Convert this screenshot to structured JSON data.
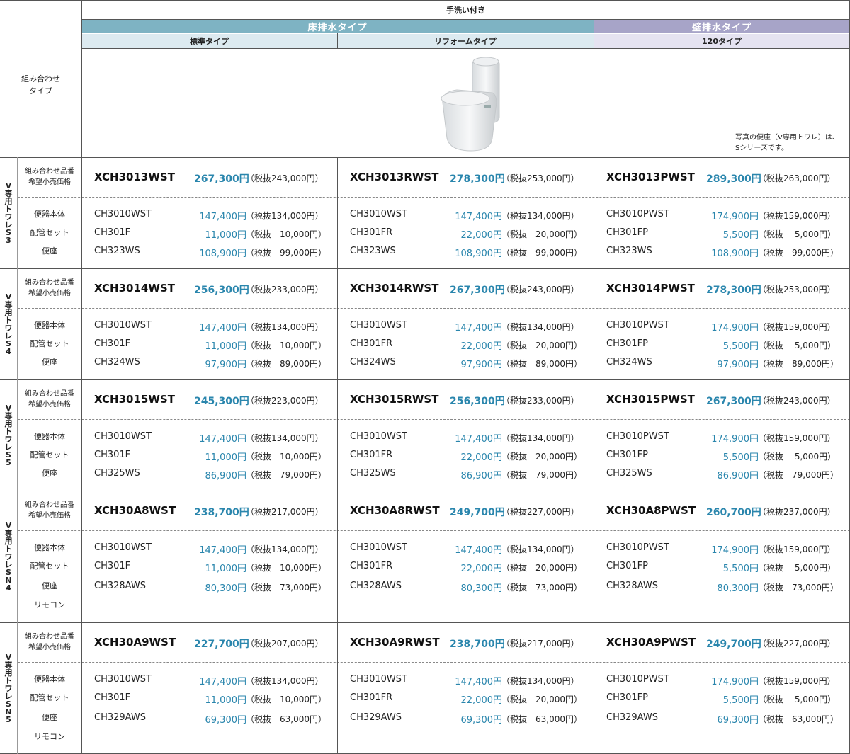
{
  "header": {
    "top": "手洗い付き",
    "floor_band": "床排水タイプ",
    "wall_band": "壁排水タイプ",
    "sub_standard": "標準タイプ",
    "sub_reform": "リフォームタイプ",
    "sub_120": "120タイプ"
  },
  "combo_type_label": [
    "組み合わせ",
    "タイプ"
  ],
  "photo_note": [
    "写真の便座（V専用トワレ）は、",
    "Sシリーズです。"
  ],
  "row_labels": {
    "combo": [
      "組み合わせ品番",
      "希望小売価格"
    ],
    "body": "便器本体",
    "pipe": "配管セット",
    "seat": "便座",
    "remote": "リモコン"
  },
  "colors": {
    "floor_band": "#7eb3c3",
    "wall_band": "#a7a4c8",
    "price": "#2a86ad"
  },
  "groups": [
    {
      "series": "V専用トワレS3",
      "cols": [
        {
          "code": "XCH3013WST",
          "price": "267,300円",
          "tax": "（税抜243,000円）",
          "parts": [
            {
              "code": "CH3010WST",
              "price": "147,400円",
              "tax": "（税抜134,000円）"
            },
            {
              "code": "CH301F",
              "price": "11,000円",
              "tax": "（税抜　10,000円）"
            },
            {
              "code": "CH323WS",
              "price": "108,900円",
              "tax": "（税抜　99,000円）"
            }
          ]
        },
        {
          "code": "XCH3013RWST",
          "price": "278,300円",
          "tax": "（税抜253,000円）",
          "parts": [
            {
              "code": "CH3010WST",
              "price": "147,400円",
              "tax": "（税抜134,000円）"
            },
            {
              "code": "CH301FR",
              "price": "22,000円",
              "tax": "（税抜　20,000円）"
            },
            {
              "code": "CH323WS",
              "price": "108,900円",
              "tax": "（税抜　99,000円）"
            }
          ]
        },
        {
          "code": "XCH3013PWST",
          "price": "289,300円",
          "tax": "（税抜263,000円）",
          "parts": [
            {
              "code": "CH3010PWST",
              "price": "174,900円",
              "tax": "（税抜159,000円）"
            },
            {
              "code": "CH301FP",
              "price": "5,500円",
              "tax": "（税抜　 5,000円）"
            },
            {
              "code": "CH323WS",
              "price": "108,900円",
              "tax": "（税抜　99,000円）"
            }
          ]
        }
      ]
    },
    {
      "series": "V専用トワレS4",
      "cols": [
        {
          "code": "XCH3014WST",
          "price": "256,300円",
          "tax": "（税抜233,000円）",
          "parts": [
            {
              "code": "CH3010WST",
              "price": "147,400円",
              "tax": "（税抜134,000円）"
            },
            {
              "code": "CH301F",
              "price": "11,000円",
              "tax": "（税抜　10,000円）"
            },
            {
              "code": "CH324WS",
              "price": "97,900円",
              "tax": "（税抜　89,000円）"
            }
          ]
        },
        {
          "code": "XCH3014RWST",
          "price": "267,300円",
          "tax": "（税抜243,000円）",
          "parts": [
            {
              "code": "CH3010WST",
              "price": "147,400円",
              "tax": "（税抜134,000円）"
            },
            {
              "code": "CH301FR",
              "price": "22,000円",
              "tax": "（税抜　20,000円）"
            },
            {
              "code": "CH324WS",
              "price": "97,900円",
              "tax": "（税抜　89,000円）"
            }
          ]
        },
        {
          "code": "XCH3014PWST",
          "price": "278,300円",
          "tax": "（税抜253,000円）",
          "parts": [
            {
              "code": "CH3010PWST",
              "price": "174,900円",
              "tax": "（税抜159,000円）"
            },
            {
              "code": "CH301FP",
              "price": "5,500円",
              "tax": "（税抜　 5,000円）"
            },
            {
              "code": "CH324WS",
              "price": "97,900円",
              "tax": "（税抜　89,000円）"
            }
          ]
        }
      ]
    },
    {
      "series": "V専用トワレS5",
      "cols": [
        {
          "code": "XCH3015WST",
          "price": "245,300円",
          "tax": "（税抜223,000円）",
          "parts": [
            {
              "code": "CH3010WST",
              "price": "147,400円",
              "tax": "（税抜134,000円）"
            },
            {
              "code": "CH301F",
              "price": "11,000円",
              "tax": "（税抜　10,000円）"
            },
            {
              "code": "CH325WS",
              "price": "86,900円",
              "tax": "（税抜　79,000円）"
            }
          ]
        },
        {
          "code": "XCH3015RWST",
          "price": "256,300円",
          "tax": "（税抜233,000円）",
          "parts": [
            {
              "code": "CH3010WST",
              "price": "147,400円",
              "tax": "（税抜134,000円）"
            },
            {
              "code": "CH301FR",
              "price": "22,000円",
              "tax": "（税抜　20,000円）"
            },
            {
              "code": "CH325WS",
              "price": "86,900円",
              "tax": "（税抜　79,000円）"
            }
          ]
        },
        {
          "code": "XCH3015PWST",
          "price": "267,300円",
          "tax": "（税抜243,000円）",
          "parts": [
            {
              "code": "CH3010PWST",
              "price": "174,900円",
              "tax": "（税抜159,000円）"
            },
            {
              "code": "CH301FP",
              "price": "5,500円",
              "tax": "（税抜　 5,000円）"
            },
            {
              "code": "CH325WS",
              "price": "86,900円",
              "tax": "（税抜　79,000円）"
            }
          ]
        }
      ]
    },
    {
      "series": "V専用トワレSN4",
      "cols": [
        {
          "code": "XCH30A8WST",
          "price": "238,700円",
          "tax": "（税抜217,000円）",
          "parts": [
            {
              "code": "CH3010WST",
              "price": "147,400円",
              "tax": "（税抜134,000円）"
            },
            {
              "code": "CH301F",
              "price": "11,000円",
              "tax": "（税抜　10,000円）"
            },
            {
              "code": "CH328AWS",
              "price": "80,300円",
              "tax": "（税抜　73,000円）"
            }
          ]
        },
        {
          "code": "XCH30A8RWST",
          "price": "249,700円",
          "tax": "（税抜227,000円）",
          "parts": [
            {
              "code": "CH3010WST",
              "price": "147,400円",
              "tax": "（税抜134,000円）"
            },
            {
              "code": "CH301FR",
              "price": "22,000円",
              "tax": "（税抜　20,000円）"
            },
            {
              "code": "CH328AWS",
              "price": "80,300円",
              "tax": "（税抜　73,000円）"
            }
          ]
        },
        {
          "code": "XCH30A8PWST",
          "price": "260,700円",
          "tax": "（税抜237,000円）",
          "parts": [
            {
              "code": "CH3010PWST",
              "price": "174,900円",
              "tax": "（税抜159,000円）"
            },
            {
              "code": "CH301FP",
              "price": "5,500円",
              "tax": "（税抜　 5,000円）"
            },
            {
              "code": "CH328AWS",
              "price": "80,300円",
              "tax": "（税抜　73,000円）"
            }
          ]
        }
      ]
    },
    {
      "series": "V専用トワレSN5",
      "cols": [
        {
          "code": "XCH30A9WST",
          "price": "227,700円",
          "tax": "（税抜207,000円）",
          "parts": [
            {
              "code": "CH3010WST",
              "price": "147,400円",
              "tax": "（税抜134,000円）"
            },
            {
              "code": "CH301F",
              "price": "11,000円",
              "tax": "（税抜　10,000円）"
            },
            {
              "code": "CH329AWS",
              "price": "69,300円",
              "tax": "（税抜　63,000円）"
            }
          ]
        },
        {
          "code": "XCH30A9RWST",
          "price": "238,700円",
          "tax": "（税抜217,000円）",
          "parts": [
            {
              "code": "CH3010WST",
              "price": "147,400円",
              "tax": "（税抜134,000円）"
            },
            {
              "code": "CH301FR",
              "price": "22,000円",
              "tax": "（税抜　20,000円）"
            },
            {
              "code": "CH329AWS",
              "price": "69,300円",
              "tax": "（税抜　63,000円）"
            }
          ]
        },
        {
          "code": "XCH30A9PWST",
          "price": "249,700円",
          "tax": "（税抜227,000円）",
          "parts": [
            {
              "code": "CH3010PWST",
              "price": "174,900円",
              "tax": "（税抜159,000円）"
            },
            {
              "code": "CH301FP",
              "price": "5,500円",
              "tax": "（税抜　 5,000円）"
            },
            {
              "code": "CH329AWS",
              "price": "69,300円",
              "tax": "（税抜　63,000円）"
            }
          ]
        }
      ]
    }
  ]
}
